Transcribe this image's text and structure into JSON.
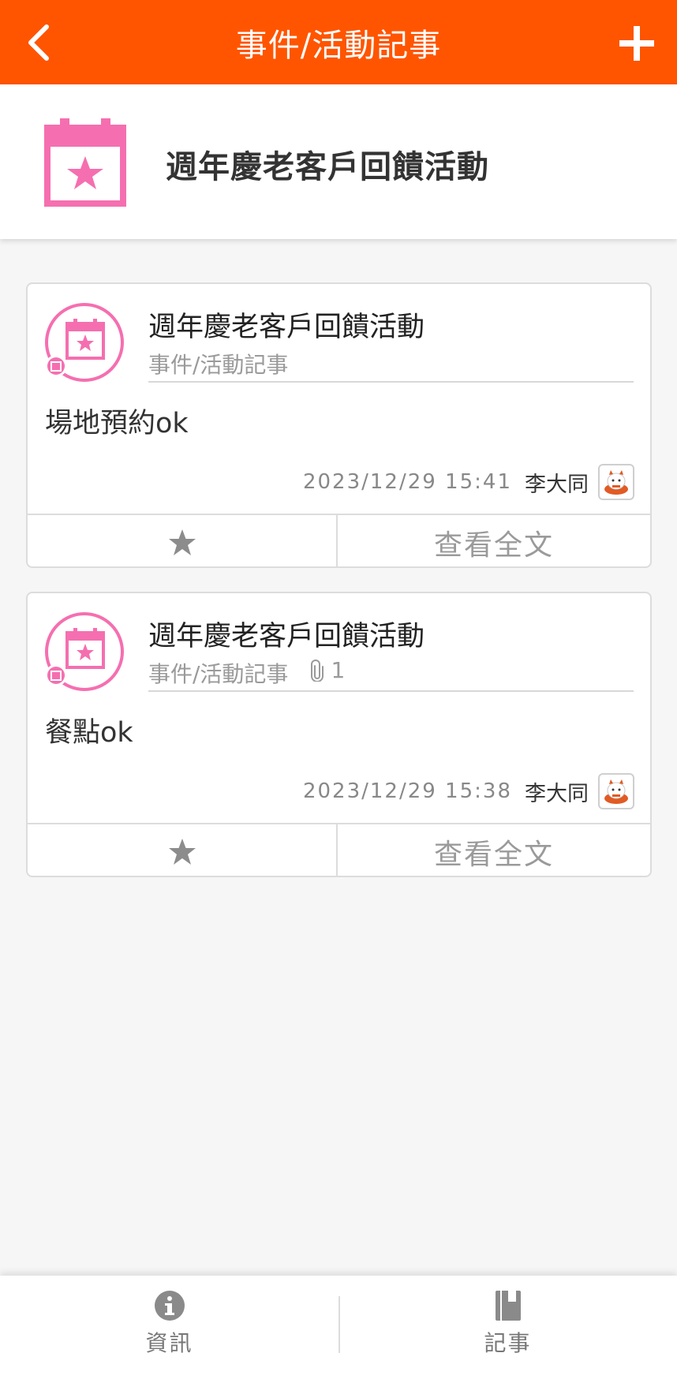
{
  "topbar": {
    "title": "事件/活動記事"
  },
  "header": {
    "title": "週年慶老客戶回饋活動"
  },
  "colors": {
    "accent": "#ff5500",
    "calendar_pink": "#f56fb0"
  },
  "cards": [
    {
      "title": "週年慶老客戶回饋活動",
      "subtitle": "事件/活動記事",
      "attachments": "",
      "body": "場地預約ok",
      "time": "2023/12/29 15:41",
      "author": "李大同",
      "view_full": "查看全文"
    },
    {
      "title": "週年慶老客戶回饋活動",
      "subtitle": "事件/活動記事",
      "attachments": "1",
      "body": "餐點ok",
      "time": "2023/12/29 15:38",
      "author": "李大同",
      "view_full": "查看全文"
    }
  ],
  "bottom_tabs": [
    {
      "label": "資訊",
      "icon": "info-icon"
    },
    {
      "label": "記事",
      "icon": "notebook-icon"
    }
  ]
}
